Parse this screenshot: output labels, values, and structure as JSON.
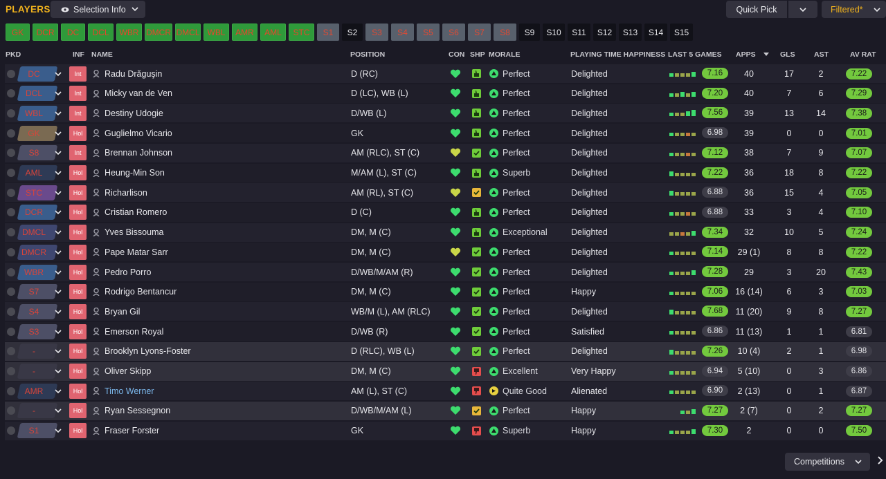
{
  "header": {
    "title": "PLAYERS",
    "selection_info": "Selection Info",
    "quick_pick": "Quick Pick",
    "filtered": "Filtered*"
  },
  "chips": [
    {
      "label": "GK",
      "style": "g"
    },
    {
      "label": "DCR",
      "style": "g"
    },
    {
      "label": "DC",
      "style": "g"
    },
    {
      "label": "DCL",
      "style": "g"
    },
    {
      "label": "WBR",
      "style": "g"
    },
    {
      "label": "DMCR",
      "style": "g"
    },
    {
      "label": "DMCL",
      "style": "g"
    },
    {
      "label": "WBL",
      "style": "g"
    },
    {
      "label": "AMR",
      "style": "g"
    },
    {
      "label": "AML",
      "style": "g"
    },
    {
      "label": "STC",
      "style": "g"
    },
    {
      "label": "S1",
      "style": "gr"
    },
    {
      "label": "S2",
      "style": "d"
    },
    {
      "label": "S3",
      "style": "gr"
    },
    {
      "label": "S4",
      "style": "gr"
    },
    {
      "label": "S5",
      "style": "gr"
    },
    {
      "label": "S6",
      "style": "gr"
    },
    {
      "label": "S7",
      "style": "gr"
    },
    {
      "label": "S8",
      "style": "gr"
    },
    {
      "label": "S9",
      "style": "d"
    },
    {
      "label": "S10",
      "style": "d"
    },
    {
      "label": "S11",
      "style": "d"
    },
    {
      "label": "S12",
      "style": "d"
    },
    {
      "label": "S13",
      "style": "d"
    },
    {
      "label": "S14",
      "style": "d"
    },
    {
      "label": "S15",
      "style": "d"
    }
  ],
  "columns": {
    "pkd": "PKD",
    "inf": "INF",
    "name": "NAME",
    "position": "POSITION",
    "con": "CON",
    "shp": "SHP",
    "morale": "MORALE",
    "pth": "PLAYING TIME HAPPINESS",
    "last5": "LAST 5 GAMES",
    "apps": "APPS",
    "gls": "GLS",
    "ast": "AST",
    "avrat": "AV RAT"
  },
  "colors": {
    "accent": "#f0b21d",
    "green_badge": "#73c93e",
    "con_green": "#3ddc6e"
  },
  "players": [
    {
      "pos": "DC",
      "inf": "Int",
      "name": "Radu Drăguşin",
      "position": "D (RC)",
      "con": "good",
      "shp": "ok",
      "shp_icon": "thumb-up",
      "morale": "Perfect",
      "mor": "up",
      "pth": "Delighted",
      "last5": "7.16",
      "l5g": true,
      "apps": "40",
      "gls": "17",
      "ast": "2",
      "avrat": "7.22",
      "avg": true,
      "bars": [
        0.55,
        0.55,
        0.55,
        0.55,
        0.75
      ],
      "barcols": [
        "#3ddc6e",
        "#9aa54a",
        "#9aa54a",
        "#9aa54a",
        "#3ddc6e"
      ]
    },
    {
      "pos": "DCL",
      "inf": "Int",
      "name": "Micky van de Ven",
      "position": "D (LC), WB (L)",
      "con": "good",
      "shp": "ok",
      "shp_icon": "thumb-up",
      "morale": "Perfect",
      "mor": "up",
      "pth": "Delighted",
      "last5": "7.20",
      "l5g": true,
      "apps": "40",
      "gls": "7",
      "ast": "6",
      "avrat": "7.29",
      "avg": true,
      "bars": [
        0.55,
        0.55,
        0.75,
        0.55,
        0.75
      ],
      "barcols": [
        "#3ddc6e",
        "#9aa54a",
        "#3ddc6e",
        "#9aa54a",
        "#3ddc6e"
      ]
    },
    {
      "pos": "WBL",
      "inf": "Int",
      "name": "Destiny Udogie",
      "position": "D/WB (L)",
      "con": "good",
      "shp": "ok",
      "shp_icon": "thumb-up",
      "morale": "Perfect",
      "mor": "up",
      "pth": "Delighted",
      "last5": "7.56",
      "l5g": true,
      "apps": "39",
      "gls": "13",
      "ast": "14",
      "avrat": "7.38",
      "avg": true,
      "bars": [
        0.55,
        0.55,
        0.55,
        0.8,
        1.0
      ],
      "barcols": [
        "#3ddc6e",
        "#9aa54a",
        "#9aa54a",
        "#3ddc6e",
        "#3ddc6e"
      ]
    },
    {
      "pos": "GK",
      "inf": "Hol",
      "name": "Guglielmo Vicario",
      "position": "GK",
      "con": "good",
      "shp": "ok",
      "shp_icon": "thumb-up",
      "morale": "Perfect",
      "mor": "up",
      "pth": "Delighted",
      "last5": "6.98",
      "l5g": false,
      "apps": "39",
      "gls": "0",
      "ast": "0",
      "avrat": "7.01",
      "avg": true,
      "bars": [
        0.55,
        0.55,
        0.55,
        0.55,
        0.55
      ],
      "barcols": [
        "#3ddc6e",
        "#9aa54a",
        "#9aa54a",
        "#c8783c",
        "#9aa54a"
      ]
    },
    {
      "pos": "S8",
      "inf": "Int",
      "name": "Brennan Johnson",
      "position": "AM (RLC), ST (C)",
      "con": "mid",
      "shp": "ok",
      "shp_icon": "check",
      "morale": "Perfect",
      "mor": "up",
      "pth": "Delighted",
      "last5": "7.12",
      "l5g": true,
      "apps": "38",
      "gls": "7",
      "ast": "9",
      "avrat": "7.07",
      "avg": true,
      "bars": [
        0.55,
        0.55,
        0.55,
        0.55,
        0.55
      ],
      "barcols": [
        "#3ddc6e",
        "#9aa54a",
        "#9aa54a",
        "#c8783c",
        "#9aa54a"
      ]
    },
    {
      "pos": "AML",
      "inf": "Hol",
      "name": "Heung-Min Son",
      "position": "M/AM (L), ST (C)",
      "con": "good",
      "shp": "ok",
      "shp_icon": "thumb-up",
      "morale": "Superb",
      "mor": "up2",
      "pth": "Delighted",
      "last5": "7.22",
      "l5g": true,
      "apps": "36",
      "gls": "18",
      "ast": "8",
      "avrat": "7.22",
      "avg": true,
      "bars": [
        0.8,
        0.55,
        0.55,
        0.55,
        0.55
      ],
      "barcols": [
        "#3ddc6e",
        "#9aa54a",
        "#9aa54a",
        "#9aa54a",
        "#9aa54a"
      ]
    },
    {
      "pos": "STC",
      "inf": "Hol",
      "name": "Richarlison",
      "position": "AM (RL), ST (C)",
      "con": "mid",
      "shp": "warn",
      "shp_icon": "check",
      "morale": "Perfect",
      "mor": "up",
      "pth": "Delighted",
      "last5": "6.88",
      "l5g": false,
      "apps": "36",
      "gls": "15",
      "ast": "4",
      "avrat": "7.05",
      "avg": true,
      "bars": [
        0.75,
        0.55,
        0.55,
        0.55,
        0.55
      ],
      "barcols": [
        "#3ddc6e",
        "#9aa54a",
        "#9aa54a",
        "#9aa54a",
        "#9aa54a"
      ]
    },
    {
      "pos": "DCR",
      "inf": "Hol",
      "name": "Cristian Romero",
      "position": "D (C)",
      "con": "good",
      "shp": "ok",
      "shp_icon": "thumb-up",
      "morale": "Perfect",
      "mor": "up",
      "pth": "Delighted",
      "last5": "6.88",
      "l5g": false,
      "apps": "33",
      "gls": "3",
      "ast": "4",
      "avrat": "7.10",
      "avg": true,
      "bars": [
        0.55,
        0.55,
        0.55,
        0.55,
        0.55
      ],
      "barcols": [
        "#3ddc6e",
        "#9aa54a",
        "#9aa54a",
        "#c8783c",
        "#9aa54a"
      ]
    },
    {
      "pos": "DMCL",
      "inf": "Hol",
      "name": "Yves Bissouma",
      "position": "DM, M (C)",
      "con": "good",
      "shp": "ok",
      "shp_icon": "thumb-up",
      "morale": "Exceptional",
      "mor": "up",
      "pth": "Delighted",
      "last5": "7.34",
      "l5g": true,
      "apps": "32",
      "gls": "10",
      "ast": "5",
      "avrat": "7.24",
      "avg": true,
      "bars": [
        0.55,
        0.55,
        0.55,
        0.55,
        0.75
      ],
      "barcols": [
        "#9aa54a",
        "#9aa54a",
        "#c8783c",
        "#9aa54a",
        "#3ddc6e"
      ]
    },
    {
      "pos": "DMCR",
      "inf": "Hol",
      "name": "Pape Matar Sarr",
      "position": "DM, M (C)",
      "con": "mid",
      "shp": "ok",
      "shp_icon": "check",
      "morale": "Perfect",
      "mor": "up",
      "pth": "Delighted",
      "last5": "7.14",
      "l5g": true,
      "apps": "29 (1)",
      "gls": "8",
      "ast": "8",
      "avrat": "7.22",
      "avg": true,
      "bars": [
        0.55,
        0.55,
        0.55,
        0.55,
        0.55
      ],
      "barcols": [
        "#3ddc6e",
        "#9aa54a",
        "#9aa54a",
        "#9aa54a",
        "#9aa54a"
      ]
    },
    {
      "pos": "WBR",
      "inf": "Hol",
      "name": "Pedro Porro",
      "position": "D/WB/M/AM (R)",
      "con": "good",
      "shp": "ok",
      "shp_icon": "check",
      "morale": "Perfect",
      "mor": "up",
      "pth": "Delighted",
      "last5": "7.28",
      "l5g": true,
      "apps": "29",
      "gls": "3",
      "ast": "20",
      "avrat": "7.43",
      "avg": true,
      "bars": [
        0.55,
        0.55,
        0.55,
        0.55,
        0.75
      ],
      "barcols": [
        "#3ddc6e",
        "#9aa54a",
        "#9aa54a",
        "#9aa54a",
        "#3ddc6e"
      ]
    },
    {
      "pos": "S7",
      "inf": "Hol",
      "name": "Rodrigo Bentancur",
      "position": "DM, M (C)",
      "con": "good",
      "shp": "ok",
      "shp_icon": "check",
      "morale": "Perfect",
      "mor": "up",
      "pth": "Happy",
      "last5": "7.06",
      "l5g": true,
      "apps": "16 (14)",
      "gls": "6",
      "ast": "3",
      "avrat": "7.03",
      "avg": true,
      "bars": [
        0.55,
        0.55,
        0.55,
        0.55,
        0.55
      ],
      "barcols": [
        "#3ddc6e",
        "#9aa54a",
        "#9aa54a",
        "#9aa54a",
        "#9aa54a"
      ]
    },
    {
      "pos": "S4",
      "inf": "Hol",
      "name": "Bryan Gil",
      "position": "WB/M (L), AM (RLC)",
      "con": "good",
      "shp": "ok",
      "shp_icon": "check",
      "morale": "Perfect",
      "mor": "up",
      "pth": "Delighted",
      "last5": "7.68",
      "l5g": true,
      "apps": "11 (20)",
      "gls": "9",
      "ast": "8",
      "avrat": "7.27",
      "avg": true,
      "bars": [
        0.75,
        0.55,
        0.55,
        0.55,
        0.55
      ],
      "barcols": [
        "#3ddc6e",
        "#9aa54a",
        "#9aa54a",
        "#9aa54a",
        "#9aa54a"
      ]
    },
    {
      "pos": "S3",
      "inf": "Hol",
      "name": "Emerson Royal",
      "position": "D/WB (R)",
      "con": "good",
      "shp": "ok",
      "shp_icon": "check",
      "morale": "Perfect",
      "mor": "up",
      "pth": "Satisfied",
      "last5": "6.86",
      "l5g": false,
      "apps": "11 (13)",
      "gls": "1",
      "ast": "1",
      "avrat": "6.81",
      "avg": false,
      "bars": [
        0.55,
        0.55,
        0.55,
        0.55,
        0.55
      ],
      "barcols": [
        "#3ddc6e",
        "#9aa54a",
        "#9aa54a",
        "#9aa54a",
        "#9aa54a"
      ]
    },
    {
      "pos": "-",
      "inf": "Hol",
      "name": "Brooklyn Lyons-Foster",
      "position": "D (RLC), WB (L)",
      "con": "good",
      "shp": "ok",
      "shp_icon": "check",
      "morale": "Perfect",
      "mor": "up",
      "pth": "Delighted",
      "last5": "7.26",
      "l5g": true,
      "apps": "10 (4)",
      "gls": "2",
      "ast": "1",
      "avrat": "6.98",
      "avg": false,
      "bars": [
        0.75,
        0.55,
        0.55,
        0.55,
        0.55
      ],
      "barcols": [
        "#3ddc6e",
        "#9aa54a",
        "#9aa54a",
        "#9aa54a",
        "#9aa54a"
      ]
    },
    {
      "pos": "-",
      "inf": "Hol",
      "name": "Oliver Skipp",
      "position": "DM, M (C)",
      "con": "good",
      "shp": "bad",
      "shp_icon": "thumb-down",
      "morale": "Excellent",
      "mor": "up2",
      "pth": "Very Happy",
      "last5": "6.94",
      "l5g": false,
      "apps": "5 (10)",
      "gls": "0",
      "ast": "3",
      "avrat": "6.86",
      "avg": false,
      "bars": [
        0.55,
        0.55,
        0.55,
        0.55,
        0.55
      ],
      "barcols": [
        "#3ddc6e",
        "#9aa54a",
        "#9aa54a",
        "#9aa54a",
        "#9aa54a"
      ]
    },
    {
      "pos": "AMR",
      "inf": "Hol",
      "name": "Timo Werner",
      "position": "AM (L), ST (C)",
      "con": "good",
      "shp": "bad",
      "shp_icon": "thumb-down",
      "morale": "Quite Good",
      "mor": "side",
      "pth": "Alienated",
      "last5": "6.90",
      "l5g": false,
      "apps": "2 (13)",
      "gls": "0",
      "ast": "1",
      "avrat": "6.87",
      "avg": false,
      "link": true,
      "bars": [
        0.55,
        0.55,
        0.55,
        0.55,
        0.55
      ],
      "barcols": [
        "#3ddc6e",
        "#9aa54a",
        "#9aa54a",
        "#9aa54a",
        "#9aa54a"
      ]
    },
    {
      "pos": "-",
      "inf": "Hol",
      "name": "Ryan Sessegnon",
      "position": "D/WB/M/AM (L)",
      "con": "good",
      "shp": "warn",
      "shp_icon": "check",
      "morale": "Perfect",
      "mor": "up",
      "pth": "Happy",
      "last5": "7.27",
      "l5g": true,
      "apps": "2 (7)",
      "gls": "0",
      "ast": "2",
      "avrat": "7.27",
      "avg": true,
      "bars": [
        0,
        0,
        0.55,
        0.55,
        0.75
      ],
      "barcols": [
        "#3ddc6e",
        "#3ddc6e",
        "#3ddc6e",
        "#9aa54a",
        "#3ddc6e"
      ]
    },
    {
      "pos": "S1",
      "inf": "Hol",
      "name": "Fraser Forster",
      "position": "GK",
      "con": "good",
      "shp": "bad",
      "shp_icon": "thumb-down",
      "morale": "Superb",
      "mor": "up2",
      "pth": "Happy",
      "last5": "7.30",
      "l5g": true,
      "apps": "2",
      "gls": "0",
      "ast": "0",
      "avrat": "7.50",
      "avg": true,
      "bars": [
        0.55,
        0.55,
        0.55,
        0.55,
        0.75
      ],
      "barcols": [
        "#3ddc6e",
        "#9aa54a",
        "#9aa54a",
        "#9aa54a",
        "#3ddc6e"
      ]
    }
  ],
  "footer": {
    "competitions": "Competitions"
  }
}
